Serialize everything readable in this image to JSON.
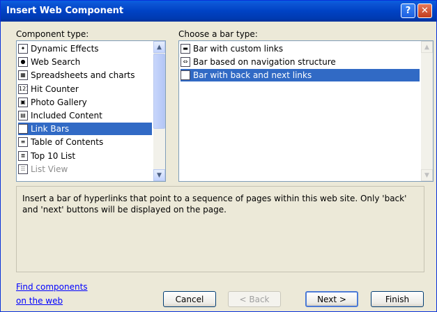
{
  "window": {
    "title": "Insert Web Component"
  },
  "titlebar": {
    "help_label": "?",
    "close_label": "✕"
  },
  "component_list": {
    "label": "Component type:",
    "items": [
      {
        "label": "Dynamic Effects",
        "icon": "dynamic-effects-icon",
        "glyph": "✦"
      },
      {
        "label": "Web Search",
        "icon": "web-search-icon",
        "glyph": "●"
      },
      {
        "label": "Spreadsheets and charts",
        "icon": "spreadsheets-icon",
        "glyph": "▦"
      },
      {
        "label": "Hit Counter",
        "icon": "hit-counter-icon",
        "glyph": "123"
      },
      {
        "label": "Photo Gallery",
        "icon": "photo-gallery-icon",
        "glyph": "▣"
      },
      {
        "label": "Included Content",
        "icon": "included-content-icon",
        "glyph": "▤"
      },
      {
        "label": "Link Bars",
        "icon": "link-bars-icon",
        "glyph": "▬"
      },
      {
        "label": "Table of Contents",
        "icon": "table-of-contents-icon",
        "glyph": "≡"
      },
      {
        "label": "Top 10 List",
        "icon": "top-10-list-icon",
        "glyph": "≣"
      },
      {
        "label": "List View",
        "icon": "list-view-icon",
        "glyph": "☰"
      }
    ],
    "selected": "Link Bars"
  },
  "bar_type_list": {
    "label": "Choose a bar type:",
    "items": [
      {
        "label": "Bar with custom links",
        "icon": "custom-links-icon",
        "glyph": "▬"
      },
      {
        "label": "Bar based on navigation structure",
        "icon": "navigation-arrows-icon",
        "glyph": "⇔"
      },
      {
        "label": "Bar with back and next links",
        "icon": "back-next-icon",
        "glyph": "▤"
      }
    ],
    "selected": "Bar with back and next links"
  },
  "description": "Insert a bar of hyperlinks that point to a sequence of pages within this web site.  Only 'back' and 'next' buttons will be displayed on the page.",
  "find_link": {
    "line1": "Find components",
    "line2": "on the web"
  },
  "buttons": {
    "cancel": "Cancel",
    "back": "< Back",
    "next": "Next >",
    "finish": "Finish"
  }
}
